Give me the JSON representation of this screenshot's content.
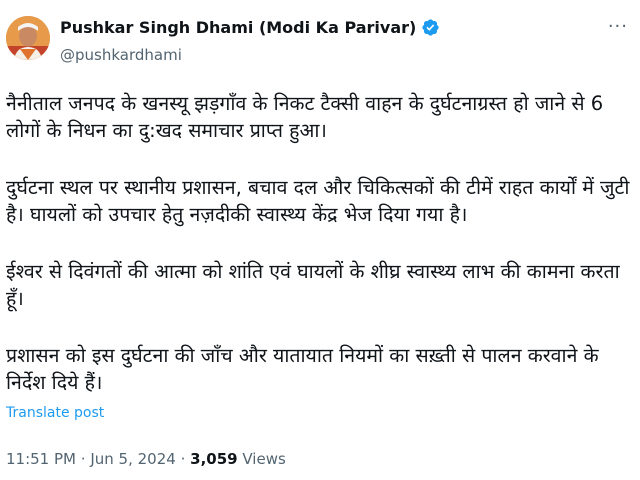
{
  "author": {
    "display_name": "Pushkar Singh Dhami (Modi Ka Parivar)",
    "handle": "@pushkardhami",
    "verified": true,
    "avatar_icon": "profile-photo",
    "verified_icon": "blue-checkmark-icon"
  },
  "menu_icon": "more-horizontal-icon",
  "post": {
    "paragraphs": [
      "नैनीताल जनपद के खनस्यू झड़गाँव के निकट टैक्सी वाहन के दुर्घटनाग्रस्त हो जाने से 6 लोगों के निधन का दु:खद समाचार प्राप्त हुआ।",
      "दुर्घटना स्थल पर स्थानीय प्रशासन, बचाव दल और चिकित्सकों की टीमें राहत कार्यों में जुटी है। घायलों को उपचार हेतु नज़दीकी स्वास्थ्य केंद्र भेज दिया गया है।",
      "ईश्वर से दिवंगतों की आत्मा को शांति एवं घायलों के शीघ्र स्वास्थ्य लाभ की कामना करता हूँ।",
      "प्रशासन को इस दुर्घटना की जाँच और यातायात नियमों का सख़्ती से पालन करवाने के निर्देश दिये हैं।"
    ]
  },
  "translate_label": "Translate post",
  "meta": {
    "time": "11:51 PM",
    "separator": "·",
    "date": "Jun 5, 2024",
    "views_count": "3,059",
    "views_label": "Views"
  },
  "colors": {
    "link": "#1d9bf0",
    "muted": "#536471",
    "text": "#0f1419"
  }
}
